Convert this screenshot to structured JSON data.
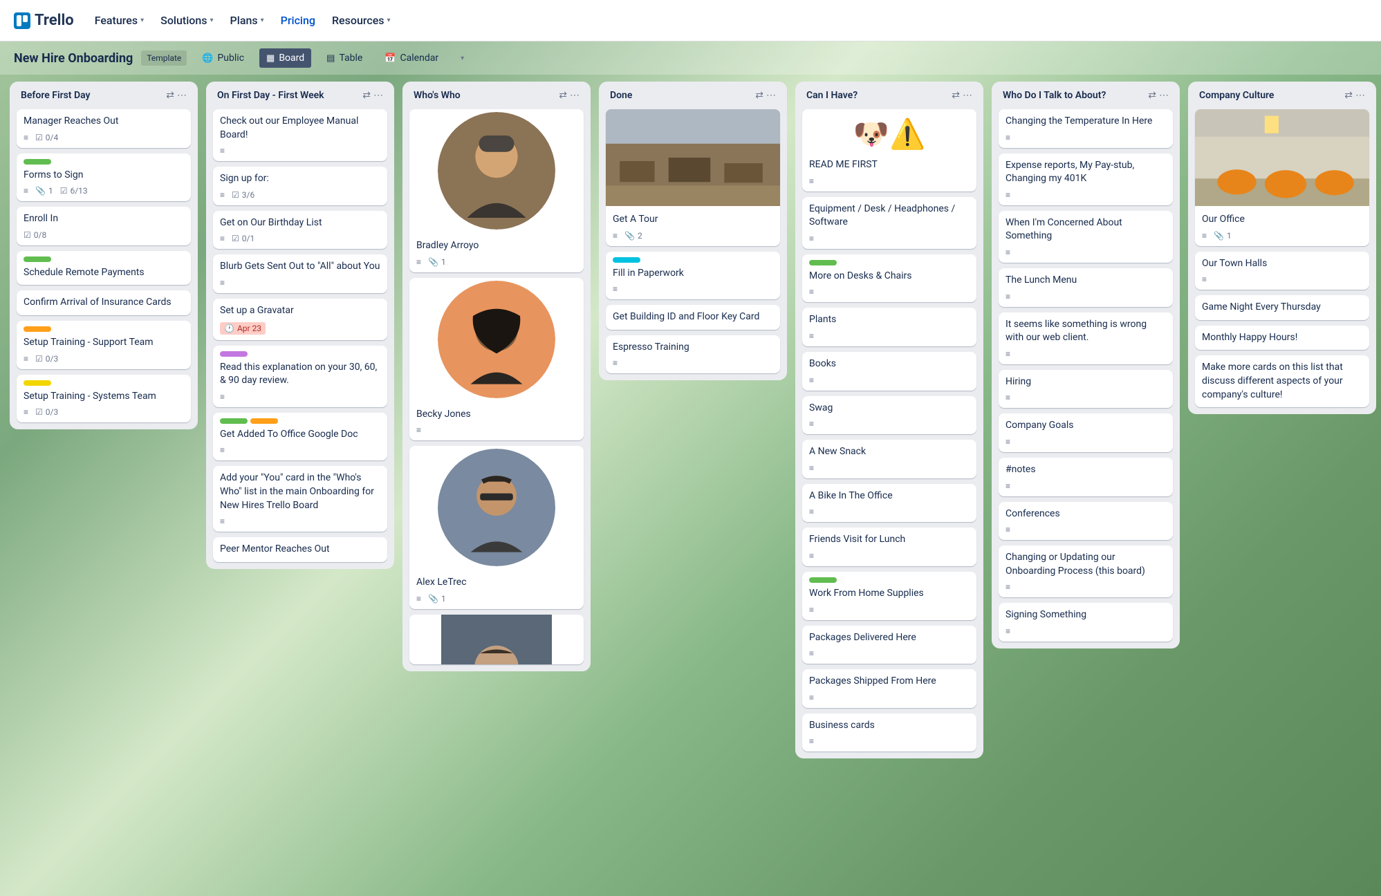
{
  "brand": "Trello",
  "nav": {
    "features": "Features",
    "solutions": "Solutions",
    "plans": "Plans",
    "pricing": "Pricing",
    "resources": "Resources"
  },
  "boardHeader": {
    "title": "New Hire Onboarding",
    "template": "Template",
    "public": "Public",
    "board": "Board",
    "table": "Table",
    "calendar": "Calendar"
  },
  "lists": {
    "beforeFirst": {
      "title": "Before First Day",
      "c0": {
        "title": "Manager Reaches Out",
        "check": "0/4"
      },
      "c1": {
        "title": "Forms to Sign",
        "attach": "1",
        "check": "6/13"
      },
      "c2": {
        "title": "Enroll In",
        "check": "0/8"
      },
      "c3": {
        "title": "Schedule Remote Payments"
      },
      "c4": {
        "title": "Confirm Arrival of Insurance Cards"
      },
      "c5": {
        "title": "Setup Training - Support Team",
        "check": "0/3"
      },
      "c6": {
        "title": "Setup Training - Systems Team",
        "check": "0/3"
      }
    },
    "firstDay": {
      "title": "On First Day - First Week",
      "c0": {
        "title": "Check out our Employee Manual Board!"
      },
      "c1": {
        "title": "Sign up for:",
        "check": "3/6"
      },
      "c2": {
        "title": "Get on Our Birthday List",
        "check": "0/1"
      },
      "c3": {
        "title": "Blurb Gets Sent Out to \"All\" about You"
      },
      "c4": {
        "title": "Set up a Gravatar",
        "date": "Apr 23"
      },
      "c5": {
        "title": "Read this explanation on your 30, 60, & 90 day review."
      },
      "c6": {
        "title": "Get Added To Office Google Doc"
      },
      "c7": {
        "title": "Add your \"You\" card in the \"Who's Who\" list in the main Onboarding for New Hires Trello Board"
      },
      "c8": {
        "title": "Peer Mentor Reaches Out"
      }
    },
    "who": {
      "title": "Who's Who",
      "c0": {
        "title": "Bradley Arroyo",
        "attach": "1"
      },
      "c1": {
        "title": "Becky Jones"
      },
      "c2": {
        "title": "Alex LeTrec",
        "attach": "1"
      }
    },
    "done": {
      "title": "Done",
      "c0": {
        "title": "Get A Tour",
        "attach": "2"
      },
      "c1": {
        "title": "Fill in Paperwork"
      },
      "c2": {
        "title": "Get Building ID and Floor Key Card"
      },
      "c3": {
        "title": "Espresso Training"
      }
    },
    "canHave": {
      "title": "Can I Have?",
      "c0": {
        "title": "READ ME FIRST"
      },
      "c1": {
        "title": "Equipment / Desk / Headphones / Software"
      },
      "c2": {
        "title": "More on Desks & Chairs"
      },
      "c3": {
        "title": "Plants"
      },
      "c4": {
        "title": "Books"
      },
      "c5": {
        "title": "Swag"
      },
      "c6": {
        "title": "A New Snack"
      },
      "c7": {
        "title": "A Bike In The Office"
      },
      "c8": {
        "title": "Friends Visit for Lunch"
      },
      "c9": {
        "title": "Work From Home Supplies"
      },
      "c10": {
        "title": "Packages Delivered Here"
      },
      "c11": {
        "title": "Packages Shipped From Here"
      },
      "c12": {
        "title": "Business cards"
      }
    },
    "talkTo": {
      "title": "Who Do I Talk to About?",
      "c0": {
        "title": "Changing the Temperature In Here"
      },
      "c1": {
        "title": "Expense reports, My Pay-stub, Changing my 401K"
      },
      "c2": {
        "title": "When I'm Concerned About Something"
      },
      "c3": {
        "title": "The Lunch Menu"
      },
      "c4": {
        "title": "It seems like something is wrong with our web client."
      },
      "c5": {
        "title": "Hiring"
      },
      "c6": {
        "title": "Company Goals"
      },
      "c7": {
        "title": "#notes"
      },
      "c8": {
        "title": "Conferences"
      },
      "c9": {
        "title": "Changing or Updating our Onboarding Process (this board)"
      },
      "c10": {
        "title": "Signing Something"
      }
    },
    "culture": {
      "title": "Company Culture",
      "c0": {
        "title": "Our Office",
        "attach": "1"
      },
      "c1": {
        "title": "Our Town Halls"
      },
      "c2": {
        "title": "Game Night Every Thursday"
      },
      "c3": {
        "title": "Monthly Happy Hours!"
      },
      "c4": {
        "title": "Make more cards on this list that discuss different aspects of your company's culture!"
      }
    }
  }
}
